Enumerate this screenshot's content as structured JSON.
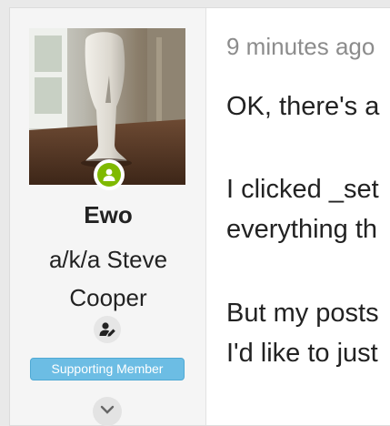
{
  "colors": {
    "online": "#7fb900",
    "badge_bg": "#6cbde4",
    "timestamp": "#8c8c8c",
    "text": "#222222"
  },
  "user": {
    "avatar_icon": "avatar-photo-icon",
    "online_icon": "online-status-icon",
    "name": "Ewo",
    "title_line1": "a/k/a Steve",
    "title_line2": "Cooper",
    "edit_icon": "user-edit-icon",
    "badge": "Supporting Member",
    "expand_icon": "chevron-down-icon"
  },
  "post": {
    "timestamp": "9 minutes ago",
    "lines": [
      "OK, there's a",
      "I clicked _set",
      "everything th",
      "But my posts",
      "I'd like to just"
    ]
  }
}
